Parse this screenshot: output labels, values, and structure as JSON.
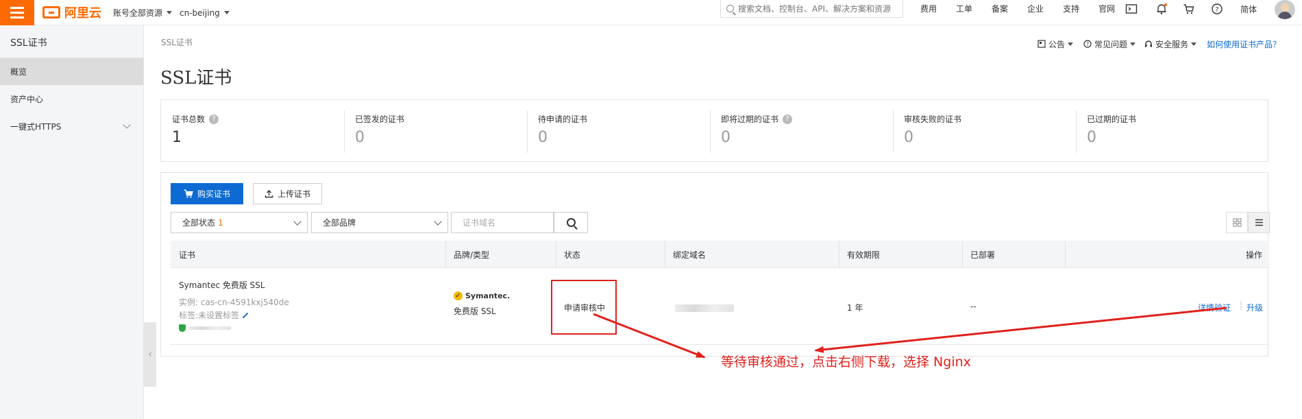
{
  "topbar": {
    "brand": "阿里云",
    "account_scope": "账号全部资源",
    "region": "cn-beijing",
    "search_placeholder": "搜索文档、控制台、API、解决方案和资源",
    "links": [
      "费用",
      "工单",
      "备案",
      "企业",
      "支持",
      "官网"
    ],
    "lang": "简体",
    "icons": [
      "terminal-icon",
      "bell-icon",
      "cart-icon",
      "help-icon"
    ],
    "accent": "#ff6a00"
  },
  "sidebar": {
    "title": "SSL证书",
    "items": [
      {
        "label": "概览",
        "active": true
      },
      {
        "label": "资产中心",
        "active": false
      },
      {
        "label": "一键式HTTPS",
        "active": false
      }
    ]
  },
  "main": {
    "breadcrumb": "SSL证书",
    "title": "SSL证书",
    "actions": {
      "notice": "公告",
      "faq": "常见问题",
      "security": "安全服务",
      "how_to": "如何使用证书产品？"
    },
    "stats": [
      {
        "label": "证书总数",
        "value": "1",
        "help": true
      },
      {
        "label": "已签发的证书",
        "value": "0",
        "help": false
      },
      {
        "label": "待申请的证书",
        "value": "0",
        "help": false
      },
      {
        "label": "即将过期的证书",
        "value": "0",
        "help": true
      },
      {
        "label": "审核失败的证书",
        "value": "0",
        "help": false
      },
      {
        "label": "已过期的证书",
        "value": "0",
        "help": false
      }
    ],
    "toolbar": {
      "buy_label": "购买证书",
      "upload_label": "上传证书",
      "status_filter": "全部状态",
      "status_count": "1",
      "brand_filter": "全部品牌",
      "domain_placeholder": "证书域名"
    },
    "table": {
      "headers": [
        "证书",
        "品牌/类型",
        "状态",
        "绑定域名",
        "有效期限",
        "已部署",
        "操作"
      ],
      "rows": [
        {
          "cert_name": "Symantec 免费版 SSL",
          "instance": "实例: cas-cn-4591kxj540de",
          "tag": "标签:未设置标签",
          "brand": "Symantec.",
          "type": "免费版 SSL",
          "status": "申请审核中",
          "validity": "1 年",
          "deployed": "--",
          "op_verify": "详情验证",
          "op_upgrade": "升级"
        }
      ]
    },
    "annotation": "等待审核通过，点击右侧下载，选择 Nginx",
    "annotation_color": "#e0201c",
    "primary_color": "#0c6ad2"
  }
}
